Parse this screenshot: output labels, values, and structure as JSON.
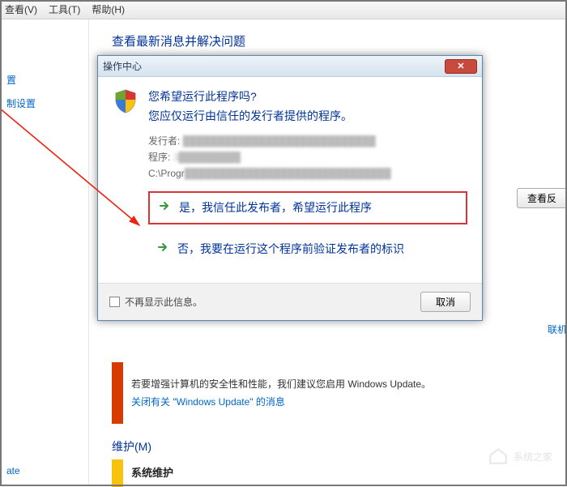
{
  "menubar": {
    "view": "查看(V)",
    "tools": "工具(T)",
    "help": "帮助(H)"
  },
  "sidebar": {
    "items": [
      "置",
      "制设置"
    ],
    "footer": "ate"
  },
  "content": {
    "heading": "查看最新消息并解决问题",
    "view_button": "查看反",
    "online": "联机",
    "update_text": "若要增强计算机的安全性和性能，我们建议您启用 Windows Update。",
    "update_link": "关闭有关 \"Windows Update\" 的消息",
    "maintenance": "维护(M)",
    "system_head": "系统维护"
  },
  "dialog": {
    "title": "操作中心",
    "q_title": "您希望运行此程序吗?",
    "q_sub": "您应仅运行由信任的发行者提供的程序。",
    "publisher_label": "发行者:",
    "publisher_value": "████████████████████████████",
    "program_label": "程序:",
    "program_value": "3█████████",
    "path_prefix": "C:\\Progr",
    "path_blur": "██████████████████████████████",
    "choice_yes": "是，我信任此发布者，希望运行此程序",
    "choice_no": "否，我要在运行这个程序前验证发布者的标识",
    "dont_show": "不再显示此信息。",
    "cancel": "取消"
  },
  "watermark": "系统之家"
}
